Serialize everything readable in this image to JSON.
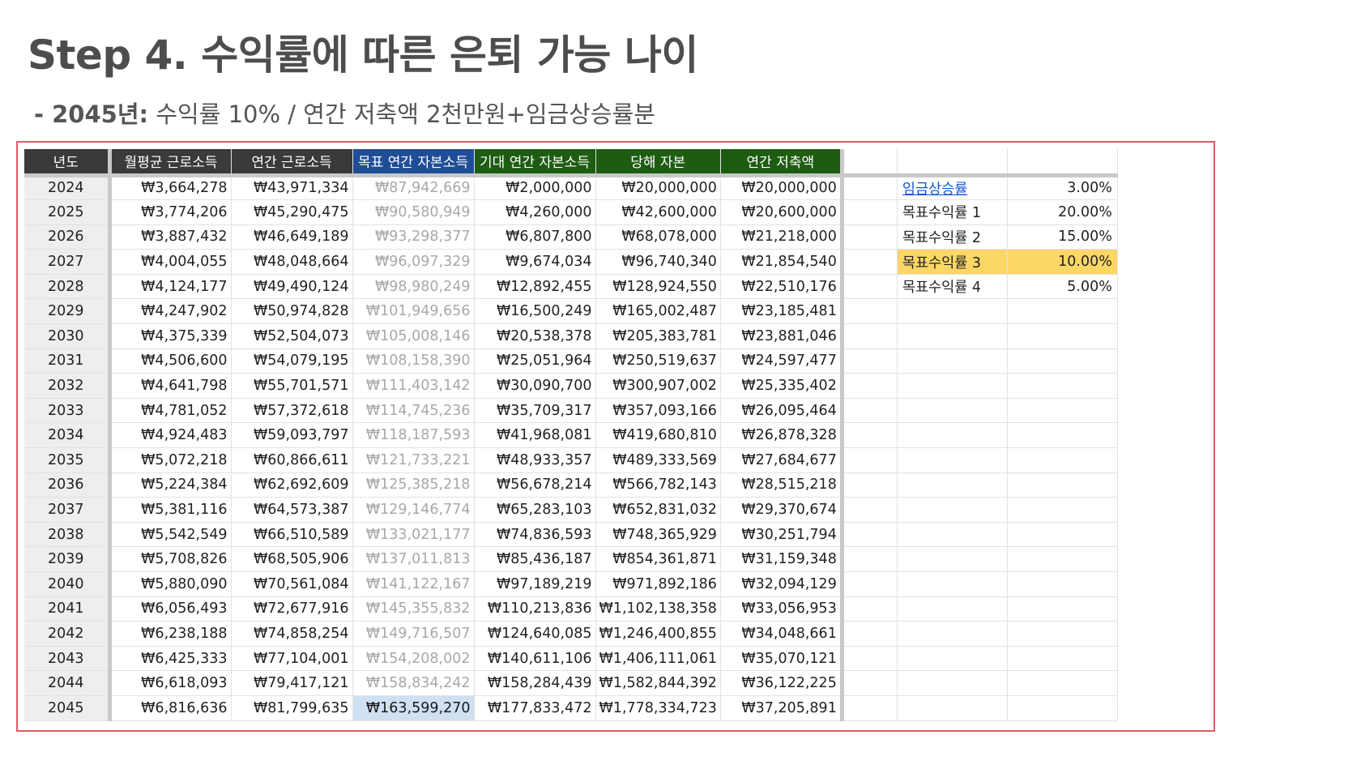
{
  "title": "Step 4. 수익률에 따른 은퇴 가능 나이",
  "subtitle": {
    "prefix": "- 2045년:",
    "text": " 수익률 10% / 연간 저축액 2천만원+임금상승률분"
  },
  "colors": {
    "frame": "#e25a65",
    "header_dark": "#3a3a3a",
    "header_blue": "#1f4e96",
    "header_green": "#1e5c12",
    "highlight": "#fcd766",
    "selected_cell": "#cfe0f3"
  },
  "table": {
    "headers": [
      "년도",
      "월평균 근로소득",
      "연간 근로소득",
      "목표 연간 자본소득",
      "기대 연간 자본소득",
      "당해 자본",
      "연간 저축액"
    ],
    "rows": [
      [
        "2024",
        "₩3,664,278",
        "₩43,971,334",
        "₩87,942,669",
        "₩2,000,000",
        "₩20,000,000",
        "₩20,000,000"
      ],
      [
        "2025",
        "₩3,774,206",
        "₩45,290,475",
        "₩90,580,949",
        "₩4,260,000",
        "₩42,600,000",
        "₩20,600,000"
      ],
      [
        "2026",
        "₩3,887,432",
        "₩46,649,189",
        "₩93,298,377",
        "₩6,807,800",
        "₩68,078,000",
        "₩21,218,000"
      ],
      [
        "2027",
        "₩4,004,055",
        "₩48,048,664",
        "₩96,097,329",
        "₩9,674,034",
        "₩96,740,340",
        "₩21,854,540"
      ],
      [
        "2028",
        "₩4,124,177",
        "₩49,490,124",
        "₩98,980,249",
        "₩12,892,455",
        "₩128,924,550",
        "₩22,510,176"
      ],
      [
        "2029",
        "₩4,247,902",
        "₩50,974,828",
        "₩101,949,656",
        "₩16,500,249",
        "₩165,002,487",
        "₩23,185,481"
      ],
      [
        "2030",
        "₩4,375,339",
        "₩52,504,073",
        "₩105,008,146",
        "₩20,538,378",
        "₩205,383,781",
        "₩23,881,046"
      ],
      [
        "2031",
        "₩4,506,600",
        "₩54,079,195",
        "₩108,158,390",
        "₩25,051,964",
        "₩250,519,637",
        "₩24,597,477"
      ],
      [
        "2032",
        "₩4,641,798",
        "₩55,701,571",
        "₩111,403,142",
        "₩30,090,700",
        "₩300,907,002",
        "₩25,335,402"
      ],
      [
        "2033",
        "₩4,781,052",
        "₩57,372,618",
        "₩114,745,236",
        "₩35,709,317",
        "₩357,093,166",
        "₩26,095,464"
      ],
      [
        "2034",
        "₩4,924,483",
        "₩59,093,797",
        "₩118,187,593",
        "₩41,968,081",
        "₩419,680,810",
        "₩26,878,328"
      ],
      [
        "2035",
        "₩5,072,218",
        "₩60,866,611",
        "₩121,733,221",
        "₩48,933,357",
        "₩489,333,569",
        "₩27,684,677"
      ],
      [
        "2036",
        "₩5,224,384",
        "₩62,692,609",
        "₩125,385,218",
        "₩56,678,214",
        "₩566,782,143",
        "₩28,515,218"
      ],
      [
        "2037",
        "₩5,381,116",
        "₩64,573,387",
        "₩129,146,774",
        "₩65,283,103",
        "₩652,831,032",
        "₩29,370,674"
      ],
      [
        "2038",
        "₩5,542,549",
        "₩66,510,589",
        "₩133,021,177",
        "₩74,836,593",
        "₩748,365,929",
        "₩30,251,794"
      ],
      [
        "2039",
        "₩5,708,826",
        "₩68,505,906",
        "₩137,011,813",
        "₩85,436,187",
        "₩854,361,871",
        "₩31,159,348"
      ],
      [
        "2040",
        "₩5,880,090",
        "₩70,561,084",
        "₩141,122,167",
        "₩97,189,219",
        "₩971,892,186",
        "₩32,094,129"
      ],
      [
        "2041",
        "₩6,056,493",
        "₩72,677,916",
        "₩145,355,832",
        "₩110,213,836",
        "₩1,102,138,358",
        "₩33,056,953"
      ],
      [
        "2042",
        "₩6,238,188",
        "₩74,858,254",
        "₩149,716,507",
        "₩124,640,085",
        "₩1,246,400,855",
        "₩34,048,661"
      ],
      [
        "2043",
        "₩6,425,333",
        "₩77,104,001",
        "₩154,208,002",
        "₩140,611,106",
        "₩1,406,111,061",
        "₩35,070,121"
      ],
      [
        "2044",
        "₩6,618,093",
        "₩79,417,121",
        "₩158,834,242",
        "₩158,284,439",
        "₩1,582,844,392",
        "₩36,122,225"
      ],
      [
        "2045",
        "₩6,816,636",
        "₩81,799,635",
        "₩163,599,270",
        "₩177,833,472",
        "₩1,778,334,723",
        "₩37,205,891"
      ]
    ]
  },
  "params": [
    {
      "label": "임금상승률",
      "value": "3.00%",
      "link": true,
      "highlight": false
    },
    {
      "label": "목표수익률 1",
      "value": "20.00%",
      "link": false,
      "highlight": false
    },
    {
      "label": "목표수익률 2",
      "value": "15.00%",
      "link": false,
      "highlight": false
    },
    {
      "label": "목표수익률 3",
      "value": "10.00%",
      "link": false,
      "highlight": true
    },
    {
      "label": "목표수익률 4",
      "value": "5.00%",
      "link": false,
      "highlight": false
    }
  ]
}
